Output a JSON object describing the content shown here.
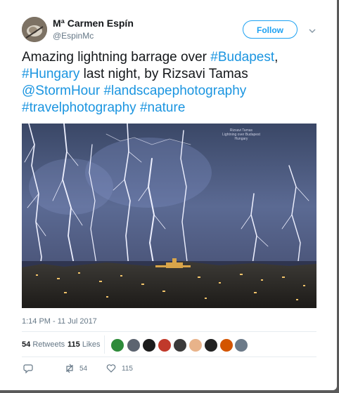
{
  "author": {
    "name": "Mª Carmen Espín",
    "handle": "@EspinMc"
  },
  "follow_label": "Follow",
  "tweet": {
    "text_1": "Amazing lightning barrage over ",
    "hashtag_budapest": "#Budapest",
    "text_2": ",",
    "hashtag_hungary": "#Hungary",
    "text_3": " last night, by Rizsavi Tamas",
    "mention_stormhour": "@StormHour",
    "hashtag_landscape": "#landscapephotography",
    "hashtag_travel": "#travelphotography",
    "hashtag_nature": "#nature"
  },
  "photo": {
    "watermark_1": "Rizsavi Tamas",
    "watermark_2": "Lightning over Budapest",
    "watermark_3": "Hungary"
  },
  "timestamp": "1:14 PM - 11 Jul 2017",
  "stats": {
    "retweets_count": "54",
    "retweets_label": "Retweets",
    "likes_count": "115",
    "likes_label": "Likes"
  },
  "likers": [
    "#2e8b3a",
    "#5c6470",
    "#1c1c1c",
    "#c0392b",
    "#3a3a3a",
    "#e8b38a",
    "#222222",
    "#d35400",
    "#6c7a89"
  ],
  "actions": {
    "retweet_count": "54",
    "like_count": "115"
  },
  "colors": {
    "link": "#1b95e0",
    "follow": "#1da1f2",
    "muted": "#657786"
  }
}
